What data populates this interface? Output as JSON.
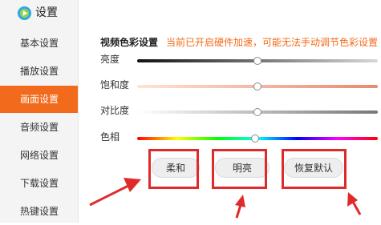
{
  "app": {
    "title": "设置"
  },
  "sidebar": {
    "items": [
      {
        "label": "基本设置",
        "active": false
      },
      {
        "label": "播放设置",
        "active": false
      },
      {
        "label": "画面设置",
        "active": true
      },
      {
        "label": "音频设置",
        "active": false
      },
      {
        "label": "网络设置",
        "active": false
      },
      {
        "label": "下载设置",
        "active": false
      },
      {
        "label": "热键设置",
        "active": false
      }
    ]
  },
  "video": {
    "section_title": "视频色彩设置",
    "notice": "当前已开启硬件加速，可能无法手动调节色彩设置",
    "sliders": {
      "brightness": {
        "label": "亮度",
        "value_percent": 50
      },
      "saturation": {
        "label": "饱和度",
        "value_percent": 50
      },
      "contrast": {
        "label": "对比度",
        "value_percent": 50
      },
      "hue": {
        "label": "色相",
        "value_percent": 49
      }
    },
    "presets": {
      "soft": "柔和",
      "bright": "明亮",
      "reset": "恢复默认"
    }
  },
  "colors": {
    "accent": "#f26a1b",
    "annotation": "#e02a2a"
  }
}
